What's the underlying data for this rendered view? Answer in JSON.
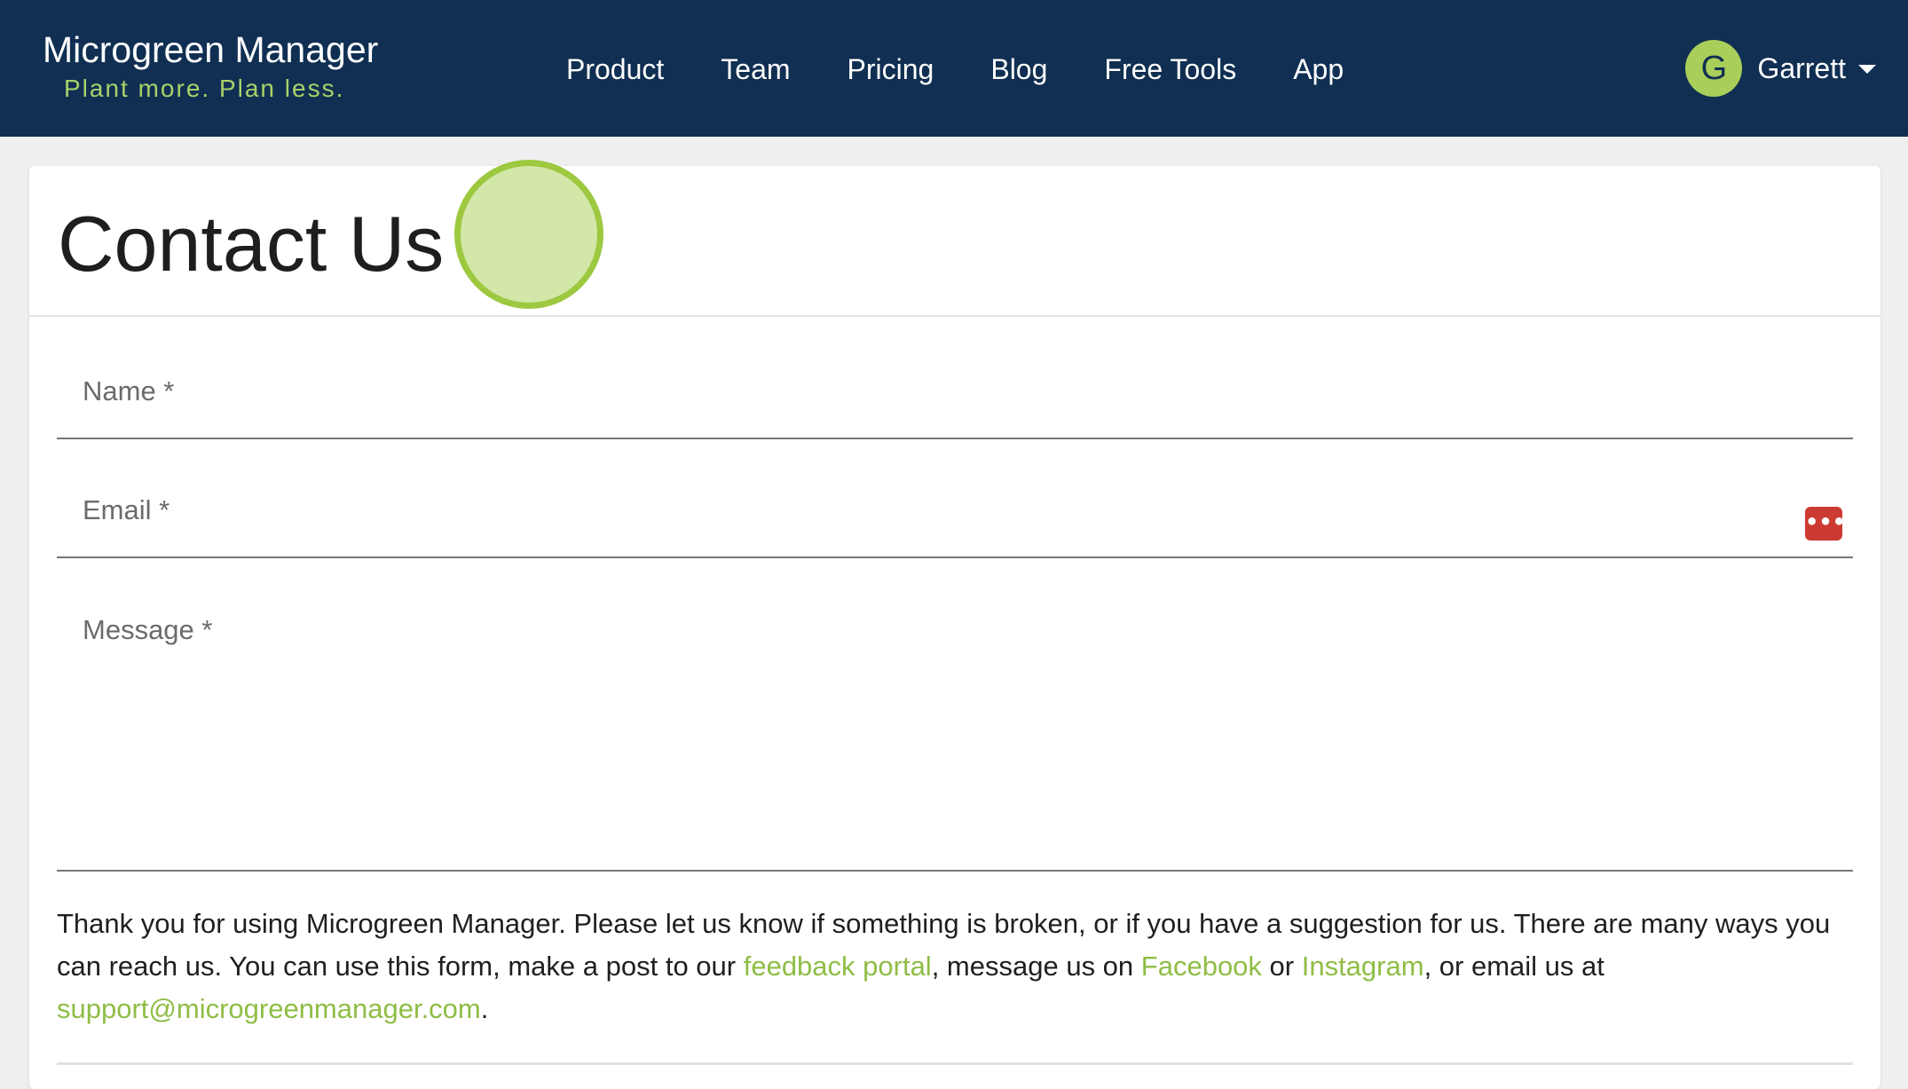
{
  "navbar": {
    "brand_title": "Microgreen Manager",
    "brand_tagline": "Plant more. Plan less.",
    "links": [
      "Product",
      "Team",
      "Pricing",
      "Blog",
      "Free Tools",
      "App"
    ],
    "user": {
      "initial": "G",
      "name": "Garrett"
    }
  },
  "page": {
    "title": "Contact Us"
  },
  "form": {
    "name_label": "Name *",
    "name_value": "",
    "email_label": "Email *",
    "email_value": "",
    "message_label": "Message *",
    "message_value": ""
  },
  "info": {
    "part1": "Thank you for using Microgreen Manager. Please let us know if something is broken, or if you have a suggestion for us. There are many ways you can reach us. You can use this form, make a post to our ",
    "link_feedback": "feedback portal",
    "part2": ", message us on ",
    "link_facebook": "Facebook",
    "part3": " or ",
    "link_instagram": "Instagram",
    "part4": ", or email us at ",
    "link_email": "support@microgreenmanager.com",
    "part5": "."
  },
  "colors": {
    "navbar_bg": "#102f52",
    "accent_green": "#a9d26a",
    "link_green": "#8fbd45",
    "password_manager_red": "#cc3b32"
  },
  "icons": {
    "user_menu": "caret-down-icon",
    "email_field": "password-manager-icon"
  }
}
